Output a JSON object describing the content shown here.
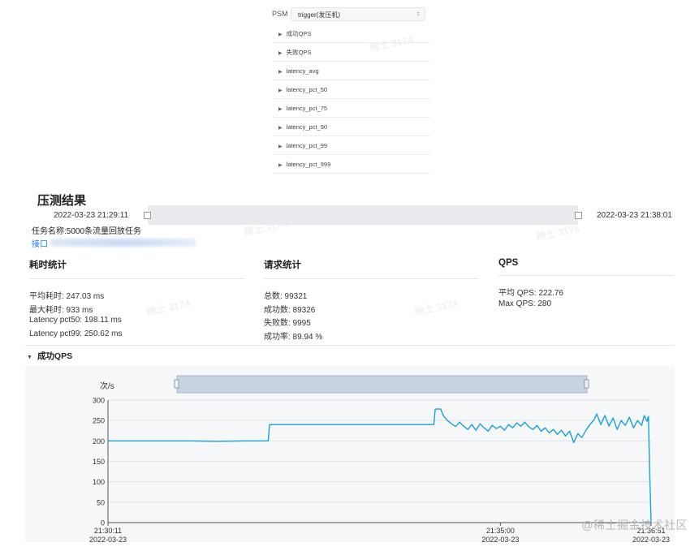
{
  "psm": {
    "label": "PSM",
    "selected": "trigger(发压机)",
    "metrics": [
      "成功QPS",
      "失败QPS",
      "latency_avg",
      "latency_pct_50",
      "latency_pct_75",
      "latency_pct_90",
      "latency_pct_99",
      "latency_pct_999"
    ]
  },
  "result": {
    "title": "压测结果",
    "time_start": "2022-03-23 21:29:11",
    "time_end": "2022-03-23 21:38:01",
    "task_name": "任务名称:5000条流量回放任务",
    "interface_label": "接口"
  },
  "stats": {
    "latency": {
      "title": "耗时统计",
      "rows": [
        "平均耗时: 247.03 ms",
        "最大耗时: 933 ms",
        "Latency pct50: 198.11 ms",
        "Latency pct99: 250.62 ms"
      ]
    },
    "requests": {
      "title": "请求统计",
      "rows": [
        "总数: 99321",
        "成功数: 89326",
        "失败数: 9995",
        "成功率: 89.94 %"
      ]
    },
    "qps": {
      "title": "QPS",
      "rows": [
        "平均 QPS: 222.76",
        "Max QPS: 280"
      ]
    }
  },
  "section": {
    "title": "成功QPS"
  },
  "chart_data": {
    "type": "line",
    "ylabel": "次/s",
    "ylim": [
      0,
      300
    ],
    "yticks": [
      0,
      50,
      100,
      150,
      200,
      250,
      300
    ],
    "x_ticks": [
      {
        "time": "21:30:11",
        "date": "2022-03-23",
        "sec": 0
      },
      {
        "time": "21:35:00",
        "date": "2022-03-23",
        "sec": 289
      },
      {
        "time": "21:36:51",
        "date": "2022-03-23",
        "sec": 400
      }
    ],
    "xlim_sec": [
      0,
      400
    ],
    "series": [
      {
        "color": "#1aa0d8",
        "points": [
          [
            0,
            200
          ],
          [
            20,
            200
          ],
          [
            40,
            200
          ],
          [
            60,
            200
          ],
          [
            80,
            199
          ],
          [
            100,
            200
          ],
          [
            110,
            200
          ],
          [
            118,
            200
          ],
          [
            119,
            240
          ],
          [
            130,
            240
          ],
          [
            150,
            240
          ],
          [
            170,
            240
          ],
          [
            190,
            240
          ],
          [
            210,
            240
          ],
          [
            230,
            240
          ],
          [
            240,
            240
          ],
          [
            241,
            278
          ],
          [
            245,
            278
          ],
          [
            247,
            262
          ],
          [
            250,
            250
          ],
          [
            253,
            242
          ],
          [
            256,
            235
          ],
          [
            259,
            246
          ],
          [
            262,
            236
          ],
          [
            265,
            228
          ],
          [
            268,
            240
          ],
          [
            271,
            226
          ],
          [
            274,
            242
          ],
          [
            277,
            232
          ],
          [
            280,
            224
          ],
          [
            283,
            238
          ],
          [
            286,
            230
          ],
          [
            289,
            236
          ],
          [
            292,
            226
          ],
          [
            295,
            240
          ],
          [
            298,
            232
          ],
          [
            301,
            244
          ],
          [
            304,
            236
          ],
          [
            307,
            246
          ],
          [
            310,
            234
          ],
          [
            313,
            228
          ],
          [
            316,
            238
          ],
          [
            319,
            224
          ],
          [
            322,
            232
          ],
          [
            325,
            220
          ],
          [
            328,
            228
          ],
          [
            331,
            216
          ],
          [
            334,
            226
          ],
          [
            337,
            212
          ],
          [
            340,
            224
          ],
          [
            343,
            196
          ],
          [
            346,
            218
          ],
          [
            349,
            208
          ],
          [
            352,
            226
          ],
          [
            355,
            240
          ],
          [
            358,
            252
          ],
          [
            360,
            266
          ],
          [
            363,
            240
          ],
          [
            366,
            262
          ],
          [
            369,
            236
          ],
          [
            372,
            256
          ],
          [
            375,
            228
          ],
          [
            378,
            250
          ],
          [
            381,
            238
          ],
          [
            384,
            258
          ],
          [
            387,
            232
          ],
          [
            390,
            250
          ],
          [
            393,
            238
          ],
          [
            395,
            262
          ],
          [
            397,
            248
          ],
          [
            398,
            260
          ],
          [
            399,
            120
          ],
          [
            400,
            0
          ]
        ]
      }
    ]
  },
  "watermark": "@稀土掘金技术社区"
}
